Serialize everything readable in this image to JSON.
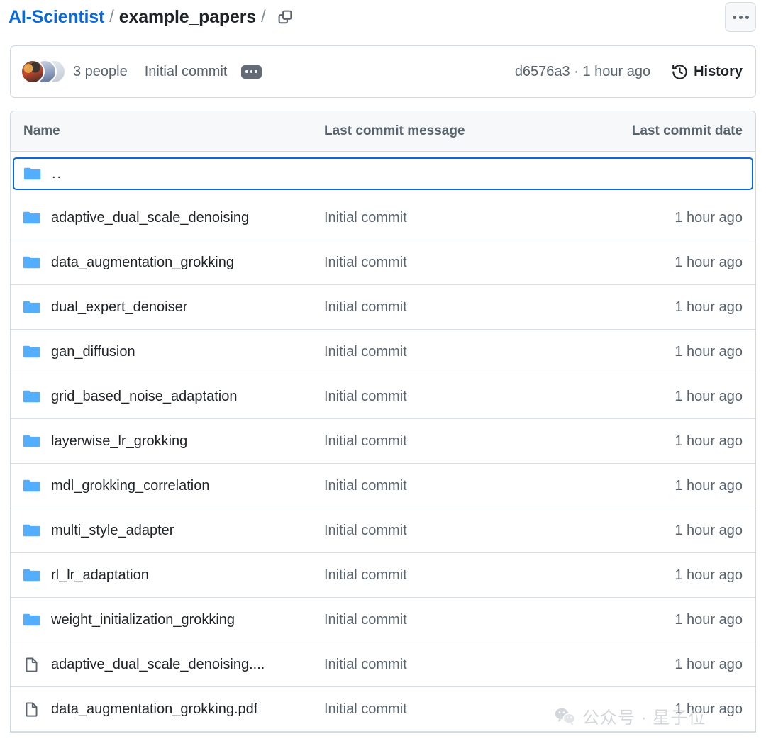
{
  "breadcrumb": {
    "repo": "AI-Scientist",
    "separator": "/",
    "current": "example_papers",
    "trailing_separator": "/",
    "copy_icon": "copy-path-icon",
    "kebab_icon": "kebab-horizontal-icon",
    "link_color": "#0969da"
  },
  "commit_bar": {
    "people": "3 people",
    "message": "Initial commit",
    "expand_icon": "ellipsis-expand-icon",
    "hash_and_time": "d6576a3 · 1 hour ago",
    "history_icon": "history-clock-icon",
    "history_label": "History"
  },
  "table": {
    "headers": {
      "name": "Name",
      "message": "Last commit message",
      "date": "Last commit date"
    },
    "rows": [
      {
        "icon": "folder-icon",
        "kind": "parent",
        "name": "..",
        "message": "",
        "date": "",
        "focused": true
      },
      {
        "icon": "folder-icon",
        "kind": "folder",
        "name": "adaptive_dual_scale_denoising",
        "message": "Initial commit",
        "date": "1 hour ago",
        "focused": false
      },
      {
        "icon": "folder-icon",
        "kind": "folder",
        "name": "data_augmentation_grokking",
        "message": "Initial commit",
        "date": "1 hour ago",
        "focused": false
      },
      {
        "icon": "folder-icon",
        "kind": "folder",
        "name": "dual_expert_denoiser",
        "message": "Initial commit",
        "date": "1 hour ago",
        "focused": false
      },
      {
        "icon": "folder-icon",
        "kind": "folder",
        "name": "gan_diffusion",
        "message": "Initial commit",
        "date": "1 hour ago",
        "focused": false
      },
      {
        "icon": "folder-icon",
        "kind": "folder",
        "name": "grid_based_noise_adaptation",
        "message": "Initial commit",
        "date": "1 hour ago",
        "focused": false
      },
      {
        "icon": "folder-icon",
        "kind": "folder",
        "name": "layerwise_lr_grokking",
        "message": "Initial commit",
        "date": "1 hour ago",
        "focused": false
      },
      {
        "icon": "folder-icon",
        "kind": "folder",
        "name": "mdl_grokking_correlation",
        "message": "Initial commit",
        "date": "1 hour ago",
        "focused": false
      },
      {
        "icon": "folder-icon",
        "kind": "folder",
        "name": "multi_style_adapter",
        "message": "Initial commit",
        "date": "1 hour ago",
        "focused": false
      },
      {
        "icon": "folder-icon",
        "kind": "folder",
        "name": "rl_lr_adaptation",
        "message": "Initial commit",
        "date": "1 hour ago",
        "focused": false
      },
      {
        "icon": "folder-icon",
        "kind": "folder",
        "name": "weight_initialization_grokking",
        "message": "Initial commit",
        "date": "1 hour ago",
        "focused": false
      },
      {
        "icon": "file-icon",
        "kind": "file",
        "name": "adaptive_dual_scale_denoising....",
        "message": "Initial commit",
        "date": "1 hour ago",
        "focused": false
      },
      {
        "icon": "file-icon",
        "kind": "file",
        "name": "data_augmentation_grokking.pdf",
        "message": "Initial commit",
        "date": "1 hour ago",
        "focused": false
      }
    ],
    "folder_icon_color": "#54aeff",
    "file_icon_color": "#59636e"
  },
  "watermark": {
    "icon": "wechat-icon",
    "text": "公众号 · 星子位"
  }
}
